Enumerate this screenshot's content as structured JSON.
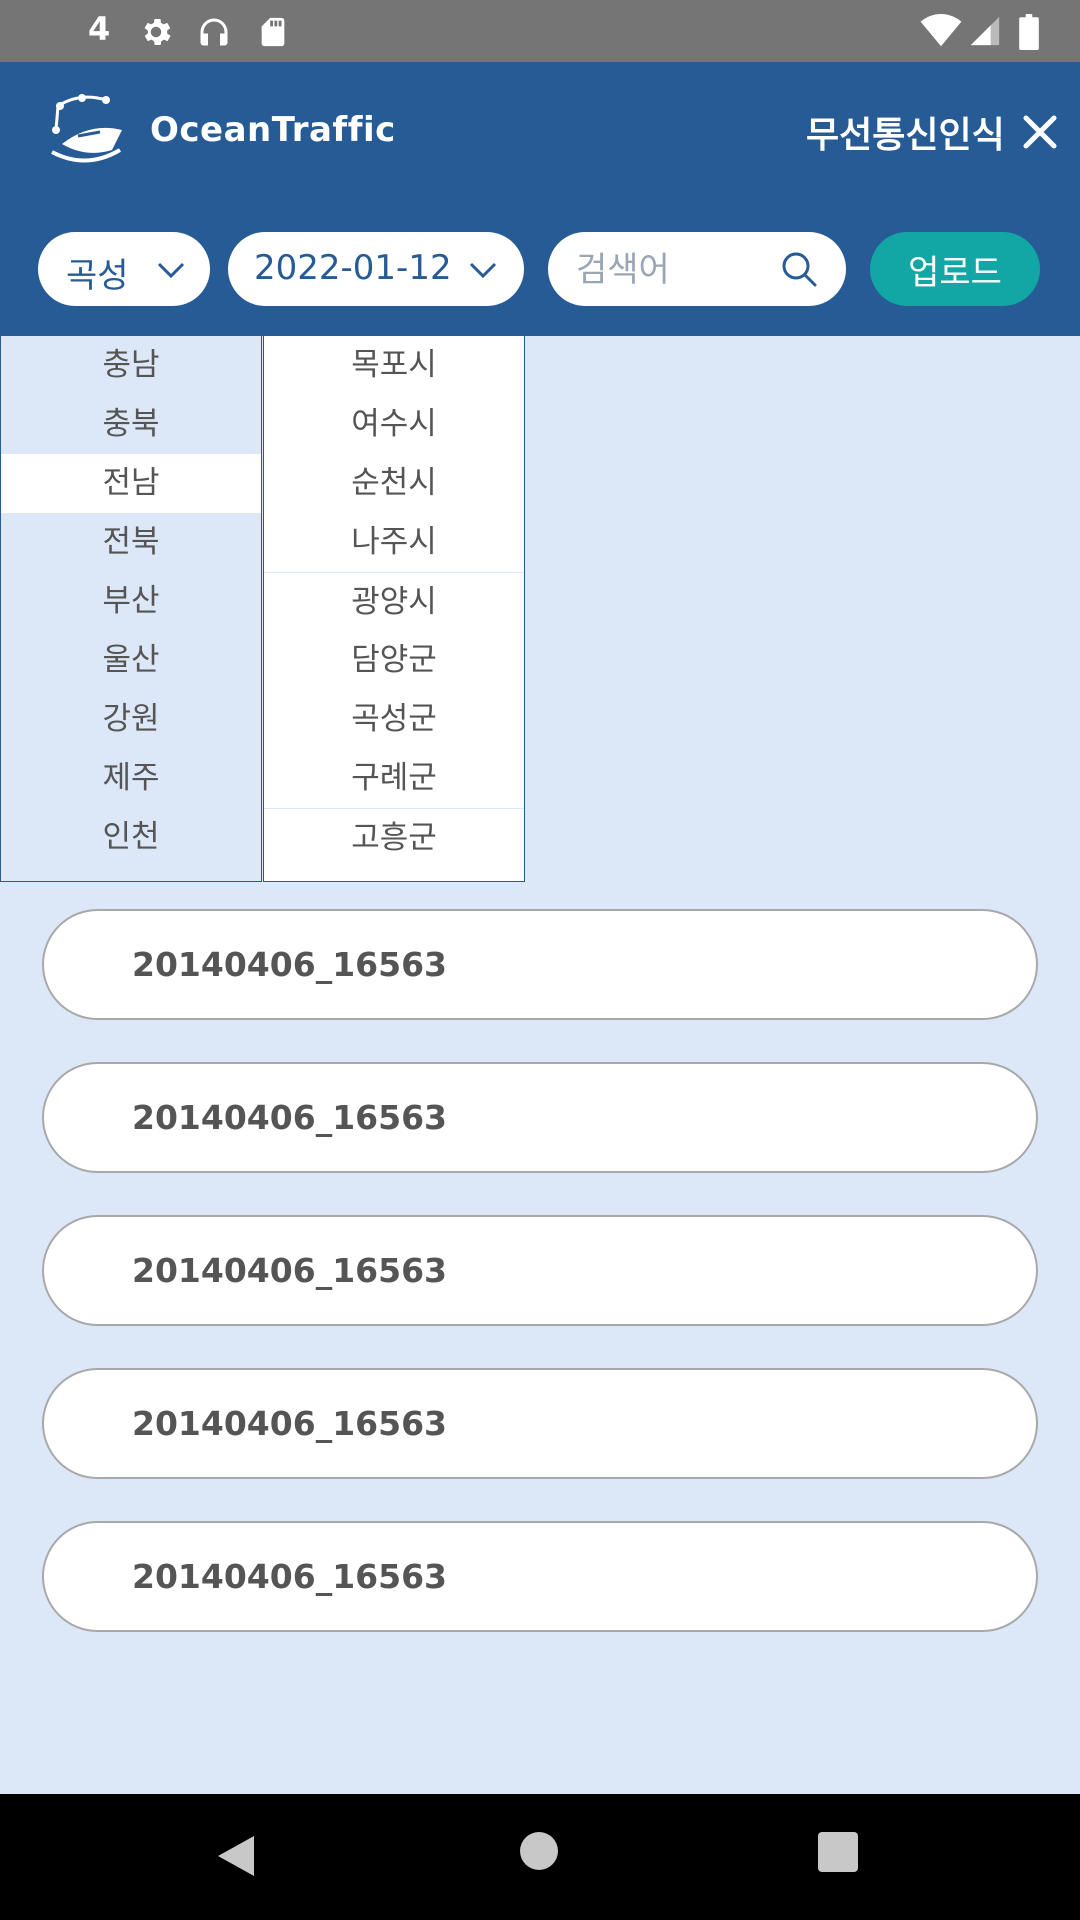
{
  "status_bar": {
    "notification_count": "4"
  },
  "header": {
    "app_name": "OceanTraffic",
    "page_title": "무선통신인식",
    "colors": {
      "header_bg": "#265b96",
      "accent": "#12a7a4",
      "page_bg": "#dce8f8"
    }
  },
  "controls": {
    "region_value": "곡성",
    "date_value": "2022-01-12",
    "search_placeholder": "검색어",
    "search_value": "",
    "upload_label": "업로드"
  },
  "dropdown": {
    "selected_province": "전남",
    "provinces": [
      "충남",
      "충북",
      "전남",
      "전북",
      "부산",
      "울산",
      "강원",
      "제주",
      "인천"
    ],
    "cities": [
      "목포시",
      "여수시",
      "순천시",
      "나주시",
      "광양시",
      "담양군",
      "곡성군",
      "구례군",
      "고흥군"
    ]
  },
  "files": [
    "20140406_16563",
    "20140406_16563",
    "20140406_16563",
    "20140406_16563",
    "20140406_16563"
  ],
  "icons": {
    "status": [
      "settings-icon",
      "headphones-icon",
      "sd-card-icon",
      "wifi-icon",
      "signal-icon",
      "battery-icon"
    ],
    "header": [
      "ship-logo-icon",
      "close-icon"
    ],
    "controls": [
      "chevron-down-icon",
      "search-icon"
    ],
    "nav": [
      "nav-back-icon",
      "nav-home-icon",
      "nav-recents-icon"
    ]
  }
}
